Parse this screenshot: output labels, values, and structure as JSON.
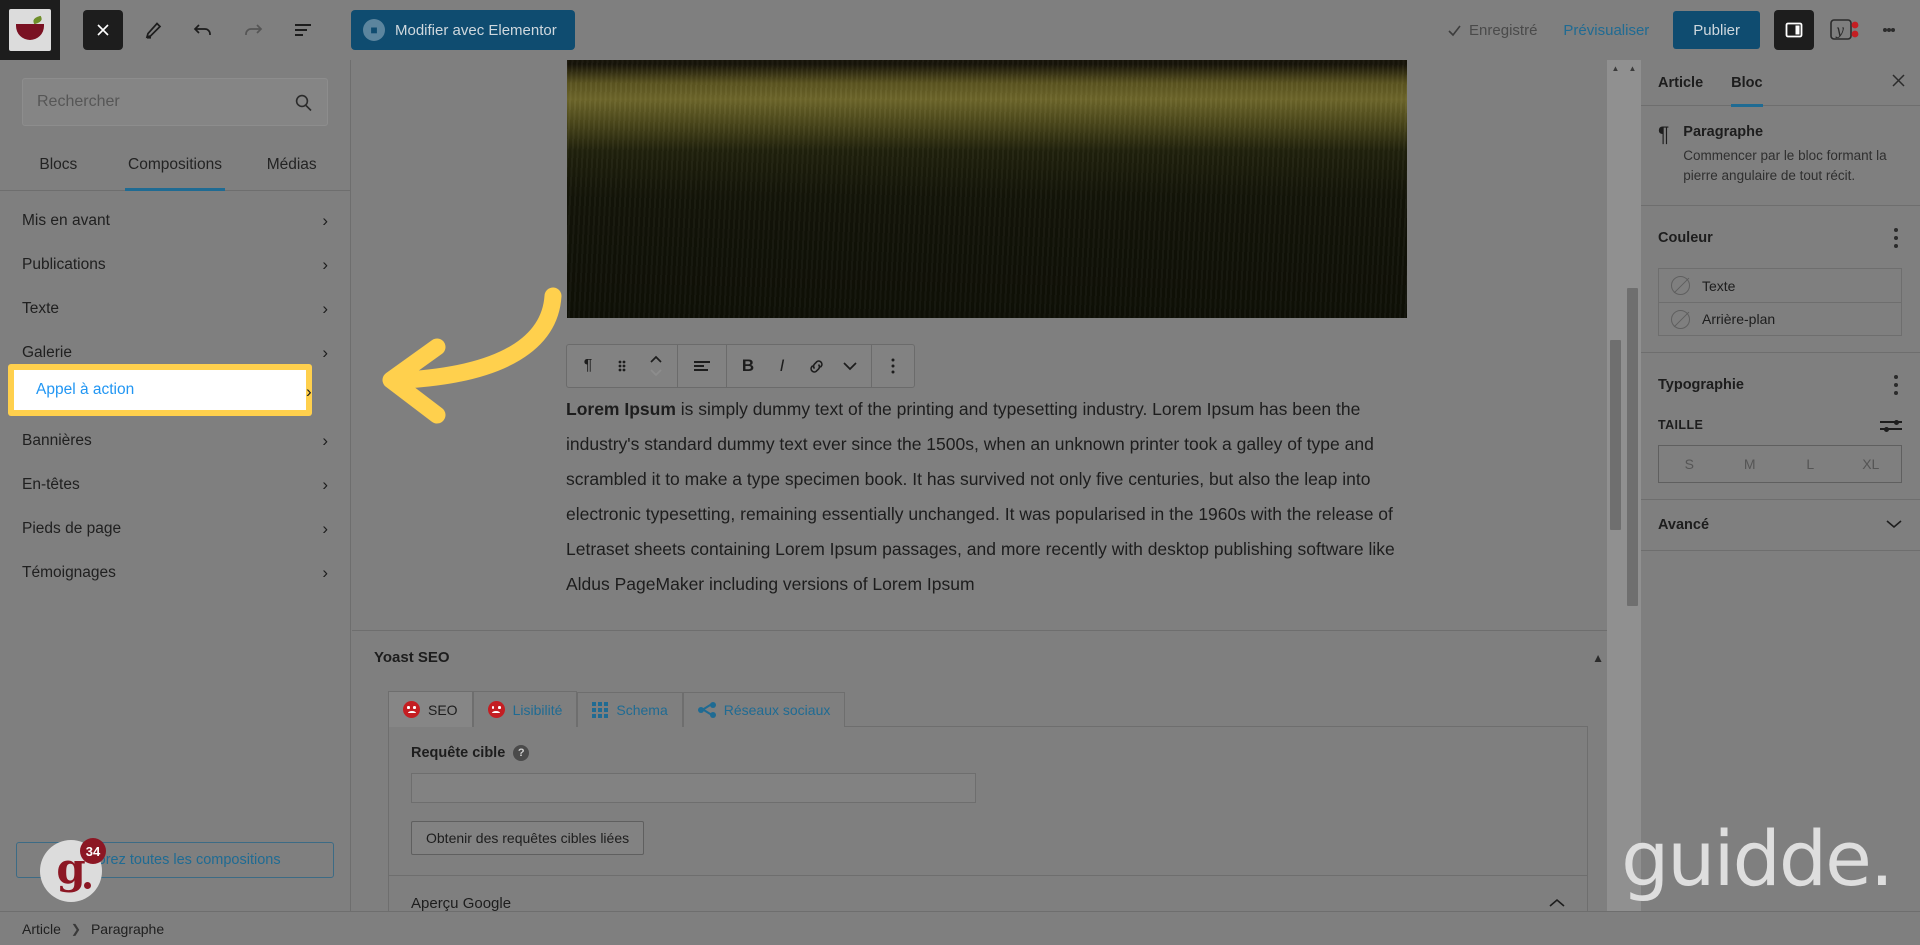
{
  "topbar": {
    "logo_icon": "wordpress-site-logo",
    "close_icon": "close-icon",
    "edit_icon": "pencil-icon",
    "undo_icon": "undo-icon",
    "redo_icon": "redo-icon",
    "list_view_icon": "document-outline-icon",
    "elementor_button": "Modifier avec Elementor",
    "elementor_icon": "elementor-icon",
    "saved_label": "Enregistré",
    "saved_check_icon": "check-icon",
    "preview_label": "Prévisualiser",
    "publish_label": "Publier",
    "settings_toggle_icon": "sidebar-toggle-icon",
    "yoast_icon": "yoast-seo-icon",
    "kebab_icon": "more-options-icon"
  },
  "inserter": {
    "search_placeholder": "Rechercher",
    "search_value": "",
    "search_icon": "search-icon",
    "tabs": [
      {
        "label": "Blocs",
        "active": false
      },
      {
        "label": "Compositions",
        "active": true
      },
      {
        "label": "Médias",
        "active": false
      }
    ],
    "categories": [
      {
        "label": "Mis en avant"
      },
      {
        "label": "Publications"
      },
      {
        "label": "Texte"
      },
      {
        "label": "Galerie"
      },
      {
        "label": "Appel à action",
        "highlighted": true
      },
      {
        "label": "Bannières"
      },
      {
        "label": "En-têtes"
      },
      {
        "label": "Pieds de page"
      },
      {
        "label": "Témoignages"
      }
    ],
    "chevron_icon": "chevron-right-icon",
    "explore_button": "Explorez toutes les compositions"
  },
  "breadcrumb": {
    "items": [
      "Article",
      "Paragraphe"
    ],
    "separator_icon": "chevron-right-icon"
  },
  "canvas": {
    "featured_image_alt": "dark-grass-field-photo",
    "block_toolbar": {
      "paragraph_icon": "paragraph-type-icon",
      "drag_icon": "drag-handle-icon",
      "move_icon": "move-up-down-icon",
      "align_icon": "text-align-icon",
      "bold_icon": "bold-icon",
      "bold_label": "B",
      "italic_icon": "italic-icon",
      "italic_label": "I",
      "link_icon": "link-icon",
      "more_formats_icon": "chevron-down-icon",
      "options_icon": "more-options-icon"
    },
    "paragraph_lead": "Lorem Ipsum",
    "paragraph_rest": " is simply dummy text of the printing and typesetting industry. Lorem Ipsum has been the industry's standard dummy text ever since the 1500s, when an unknown printer took a galley of type and scrambled it to make a type specimen book. It has survived not only five centuries, but also the leap into electronic typesetting, remaining essentially unchanged. It was popularised in the 1960s with the release of Letraset sheets containing Lorem Ipsum passages, and more recently with desktop publishing software like Aldus PageMaker including versions of Lorem Ipsum"
  },
  "yoast": {
    "title": "Yoast SEO",
    "collapse_icon": "chevron-up-icon",
    "tabs": [
      {
        "label": "SEO",
        "icon": "seo-score-bad-icon",
        "active": true
      },
      {
        "label": "Lisibilité",
        "icon": "readability-score-bad-icon",
        "active": false
      },
      {
        "label": "Schema",
        "icon": "schema-grid-icon",
        "active": false
      },
      {
        "label": "Réseaux sociaux",
        "icon": "share-icon",
        "active": false
      }
    ],
    "keyphrase_label": "Requête cible",
    "keyphrase_help_icon": "help-icon",
    "keyphrase_value": "",
    "related_button": "Obtenir des requêtes cibles liées",
    "google_preview_label": "Aperçu Google",
    "google_preview_icon": "chevron-up-icon"
  },
  "settings": {
    "tabs": [
      {
        "label": "Article",
        "active": false
      },
      {
        "label": "Bloc",
        "active": true
      }
    ],
    "close_icon": "close-icon",
    "block": {
      "icon": "paragraph-pilcrow-icon",
      "glyph": "¶",
      "title": "Paragraphe",
      "description": "Commencer par le bloc formant la pierre angulaire de tout récit."
    },
    "color_section": {
      "title": "Couleur",
      "options_icon": "more-options-icon",
      "rows": [
        {
          "label": "Texte",
          "swatch_icon": "no-color-swatch-icon"
        },
        {
          "label": "Arrière-plan",
          "swatch_icon": "no-color-swatch-icon"
        }
      ]
    },
    "typography_section": {
      "title": "Typographie",
      "options_icon": "more-options-icon",
      "size_label": "TAILLE",
      "size_tool_icon": "sliders-icon",
      "sizes": [
        "S",
        "M",
        "L",
        "XL"
      ]
    },
    "advanced_section": {
      "title": "Avancé",
      "chevron_icon": "chevron-down-icon"
    }
  },
  "annotation": {
    "arrow_icon": "curved-left-arrow-annotation",
    "arrow_color": "#ffd04d",
    "highlight_color": "#ffd04d"
  },
  "guidde": {
    "badge_letter": "g",
    "badge_count": "34",
    "watermark": "guidde."
  }
}
